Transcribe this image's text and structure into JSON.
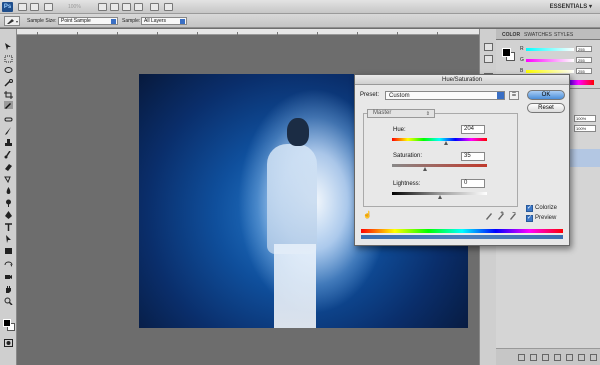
{
  "app": {
    "logo": "Ps",
    "zoom": "100%",
    "workspace": "ESSENTIALS"
  },
  "options": {
    "sample_size_label": "Sample Size:",
    "sample_size_value": "Point Sample",
    "sample_label": "Sample:",
    "sample_value": "All Layers"
  },
  "panels": {
    "tabs": [
      "COLOR",
      "SWATCHES",
      "STYLES"
    ],
    "color": {
      "channels": [
        {
          "label": "R",
          "value": "255"
        },
        {
          "label": "G",
          "value": "255"
        },
        {
          "label": "B",
          "value": "255"
        }
      ]
    },
    "layers": {
      "opacity": "100%",
      "fill": "100%"
    }
  },
  "dialog": {
    "title": "Hue/Saturation",
    "preset_label": "Preset:",
    "preset_value": "Custom",
    "range_value": "Master",
    "hue_label": "Hue:",
    "hue_value": "204",
    "saturation_label": "Saturation:",
    "saturation_value": "35",
    "lightness_label": "Lightness:",
    "lightness_value": "0",
    "ok_label": "OK",
    "reset_label": "Reset",
    "colorize_label": "Colorize",
    "preview_label": "Preview",
    "colorize_checked": true,
    "preview_checked": true
  }
}
